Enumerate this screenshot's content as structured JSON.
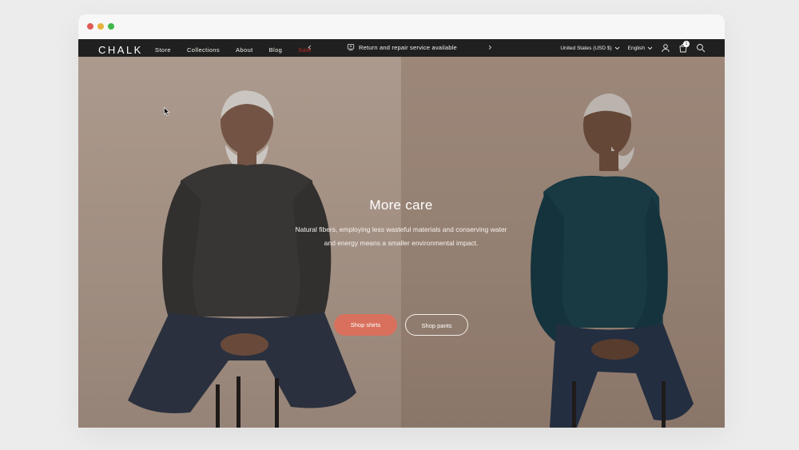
{
  "announcement": {
    "icon": "repair-icon",
    "text": "Return and repair service available"
  },
  "header": {
    "logo": "CHALK",
    "menu": [
      "Store",
      "Collections",
      "About",
      "Blog",
      "Sale"
    ],
    "country_selector": "United States (USD $)",
    "language_selector": "English",
    "cart_count": "1"
  },
  "hero": {
    "title": "More care",
    "body": "Natural fibers, employing less wasteful materials and conserving water and energy means a smaller environmental impact.",
    "primary_button": "Shop shirts",
    "secondary_button": "Shop pants",
    "slide_count": 3,
    "active_slide": 3
  },
  "colors": {
    "accent": "#d8705d",
    "sale": "#c1291f",
    "announcement_bg": "#202020"
  }
}
